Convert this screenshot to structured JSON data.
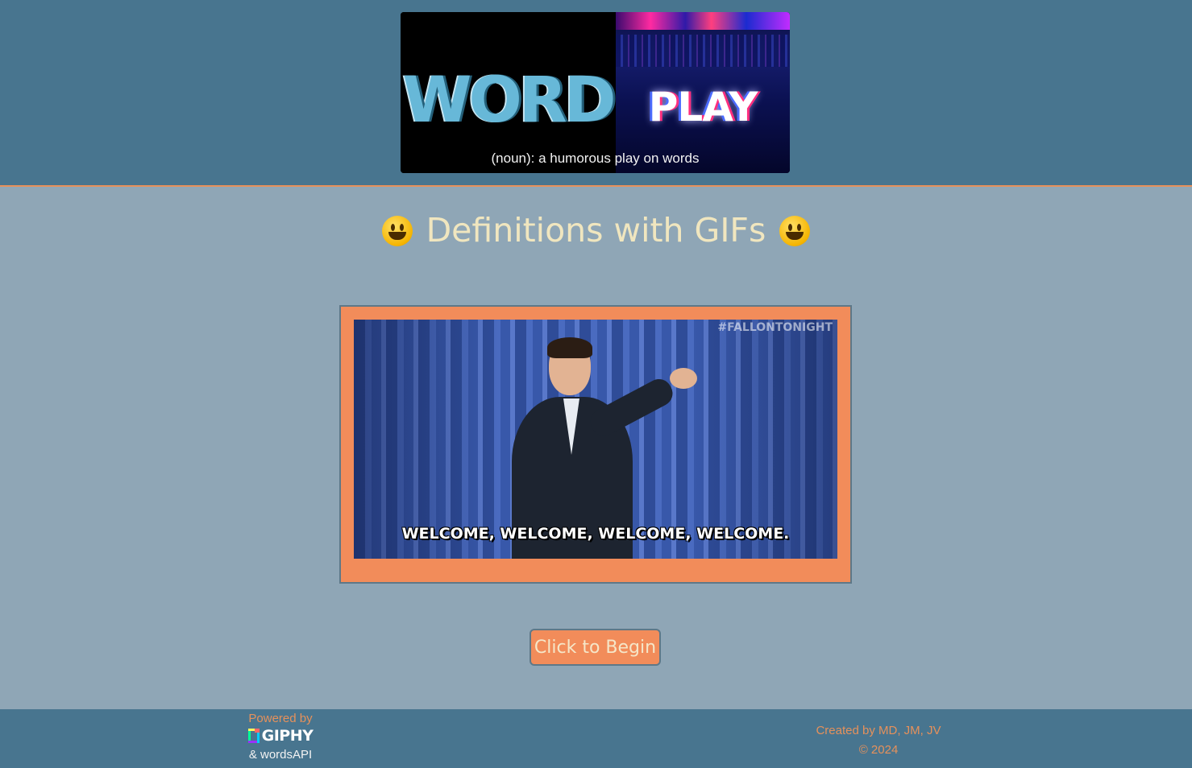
{
  "banner": {
    "word_text": "WORD",
    "play_text": "PLAY",
    "caption": "(noun): a humorous play on words"
  },
  "page": {
    "title": "Definitions with GIFs",
    "emoji_icon": "grinning-face-icon"
  },
  "gif": {
    "watermark": "#FALLONTONIGHT",
    "caption": "WELCOME, WELCOME, WELCOME, WELCOME."
  },
  "button": {
    "label": "Click to Begin"
  },
  "footer": {
    "powered_by": "Powered by",
    "giphy": "GIPHY",
    "wordsapi": "& wordsAPI",
    "created_by": "Created by MD, JM, JV",
    "copyright": "© 2024"
  },
  "colors": {
    "header_bg": "#48758f",
    "page_bg": "#8fa6b6",
    "accent": "#f28c5a",
    "title": "#f0e6bf"
  }
}
